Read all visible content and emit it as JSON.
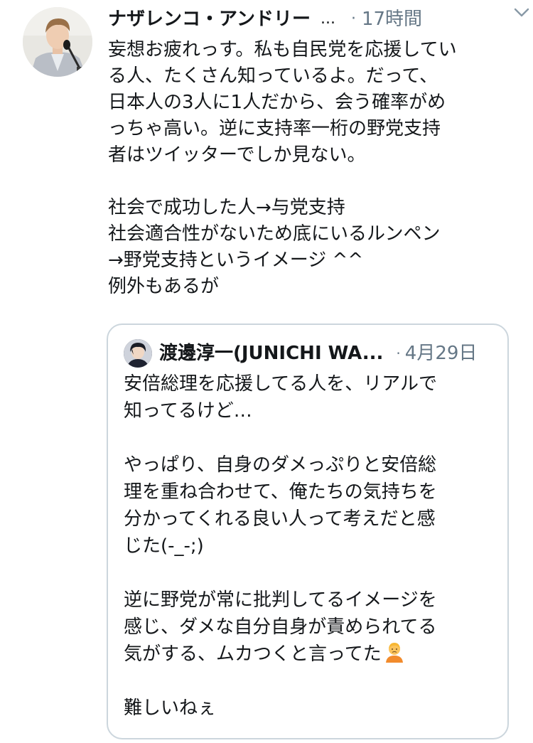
{
  "tweet": {
    "author_name": "ナザレンコ・アンドリー",
    "author_ellipsis": "...",
    "separator": "·",
    "time": "17時間",
    "body_lines": [
      "妄想お疲れっす。私も自民党を応援してい",
      "る人、たくさん知っているよ。だって、",
      "日本人の3人に1人だから、会う確率がめ",
      "っちゃ高い。逆に支持率一桁の野党支持",
      "者はツイッターでしか見ない。",
      "",
      "社会で成功した人→与党支持",
      "社会適合性がないため底にいるルンペン",
      "→野党支持というイメージ ^^",
      "例外もあるが"
    ]
  },
  "quoted": {
    "author_name": "渡邊淳一(JUNICHI WA...",
    "separator": "·",
    "time": "4月29日",
    "body_lines": [
      "安倍総理を応援してる人を、リアルで",
      "知ってるけど…",
      "",
      "やっぱり、自身のダメっぷりと安倍総",
      "理を重ね合わせて、俺たちの気持ちを",
      "分かってくれる良い人って考えだと感",
      "じた(-_-;)",
      "",
      "逆に野党が常に批判してるイメージを",
      "感じ、ダメな自分自身が責められてる",
      "気がする、ムカつくと言ってた",
      "",
      "難しいねぇ"
    ],
    "emoji_icon": "person-frowning-emoji"
  },
  "colors": {
    "text": "#14171a",
    "secondary": "#657786",
    "border": "#ccd6dd"
  }
}
